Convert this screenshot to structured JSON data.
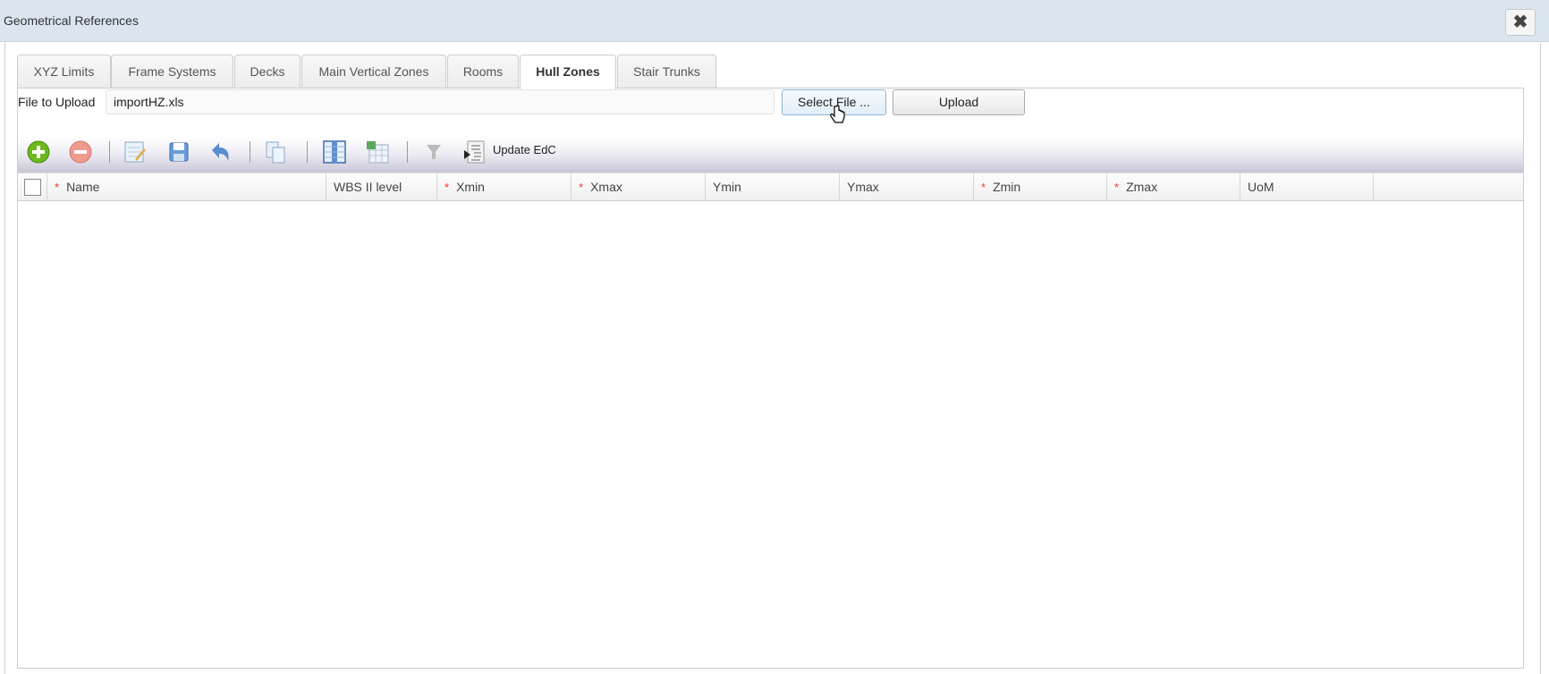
{
  "window": {
    "title": "Geometrical References",
    "close_icon": "close-icon"
  },
  "tabs": [
    {
      "label": "XYZ Limits"
    },
    {
      "label": "Frame Systems"
    },
    {
      "label": "Decks"
    },
    {
      "label": "Main Vertical Zones"
    },
    {
      "label": "Rooms"
    },
    {
      "label": "Hull Zones",
      "active": true
    },
    {
      "label": "Stair Trunks"
    }
  ],
  "upload": {
    "label": "File to Upload",
    "file_value": "importHZ.xls",
    "select_label": "Select File ...",
    "upload_label": "Upload"
  },
  "toolbar": {
    "update_label": "Update EdC"
  },
  "grid": {
    "columns": [
      {
        "label": "Name",
        "required": true
      },
      {
        "label": "WBS II level",
        "required": false
      },
      {
        "label": "Xmin",
        "required": true
      },
      {
        "label": "Xmax",
        "required": true
      },
      {
        "label": "Ymin",
        "required": false
      },
      {
        "label": "Ymax",
        "required": false
      },
      {
        "label": "Zmin",
        "required": true
      },
      {
        "label": "Zmax",
        "required": true
      },
      {
        "label": "UoM",
        "required": false
      }
    ],
    "required_mark": "*",
    "rows": []
  }
}
